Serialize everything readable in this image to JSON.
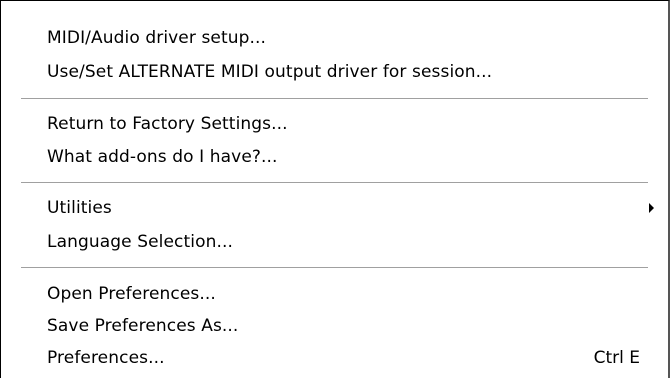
{
  "menu": {
    "groups": [
      {
        "items": [
          {
            "label": "MIDI/Audio driver setup..."
          },
          {
            "label": "Use/Set ALTERNATE MIDI output driver for session..."
          }
        ]
      },
      {
        "items": [
          {
            "label": "Return to Factory Settings..."
          },
          {
            "label": "What add-ons do I have?..."
          }
        ]
      },
      {
        "items": [
          {
            "label": "Utilities",
            "submenu_icon": "submenu-arrow-icon"
          },
          {
            "label": "Language Selection..."
          }
        ]
      },
      {
        "items": [
          {
            "label": "Open Preferences..."
          },
          {
            "label": "Save Preferences As..."
          },
          {
            "label": "Preferences...",
            "shortcut": "Ctrl E"
          }
        ]
      }
    ]
  }
}
